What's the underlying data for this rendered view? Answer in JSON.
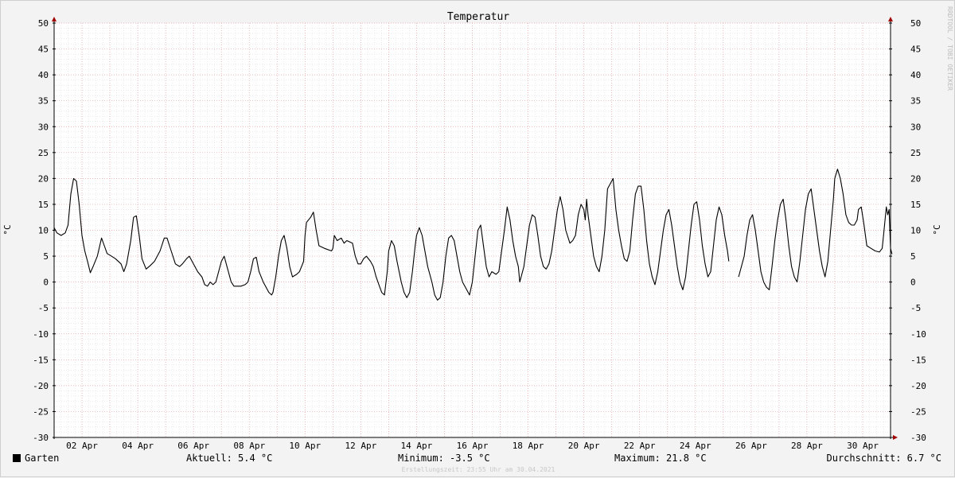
{
  "chart_data": {
    "type": "line",
    "title": "Temperatur",
    "ylabel": "°C",
    "xlabel": "",
    "ylim": [
      -30,
      50
    ],
    "y_ticks": [
      50,
      45,
      40,
      35,
      30,
      25,
      20,
      15,
      10,
      5,
      0,
      -5,
      -10,
      -15,
      -20,
      -25,
      -30
    ],
    "x_ticks": [
      "02 Apr",
      "04 Apr",
      "06 Apr",
      "08 Apr",
      "10 Apr",
      "12 Apr",
      "14 Apr",
      "16 Apr",
      "18 Apr",
      "20 Apr",
      "22 Apr",
      "24 Apr",
      "26 Apr",
      "28 Apr",
      "30 Apr"
    ],
    "x_tick_days": [
      2,
      4,
      6,
      8,
      10,
      12,
      14,
      16,
      18,
      20,
      22,
      24,
      26,
      28,
      30
    ],
    "xlim_days": [
      1.0,
      31.0
    ],
    "grid": true,
    "series": [
      {
        "name": "Garten",
        "color": "#000000",
        "points": [
          [
            1.0,
            10.5
          ],
          [
            1.1,
            9.5
          ],
          [
            1.25,
            9.0
          ],
          [
            1.4,
            9.5
          ],
          [
            1.5,
            11
          ],
          [
            1.6,
            17
          ],
          [
            1.7,
            20
          ],
          [
            1.8,
            19.5
          ],
          [
            1.9,
            15
          ],
          [
            2.0,
            9
          ],
          [
            2.1,
            6
          ],
          [
            2.2,
            4
          ],
          [
            2.3,
            1.8
          ],
          [
            2.4,
            3
          ],
          [
            2.55,
            5
          ],
          [
            2.7,
            8.5
          ],
          [
            2.8,
            7
          ],
          [
            2.9,
            5.5
          ],
          [
            3.0,
            5.2
          ],
          [
            3.2,
            4.5
          ],
          [
            3.4,
            3.5
          ],
          [
            3.5,
            2
          ],
          [
            3.6,
            3.5
          ],
          [
            3.75,
            8
          ],
          [
            3.85,
            12.5
          ],
          [
            3.95,
            12.8
          ],
          [
            4.05,
            9
          ],
          [
            4.15,
            4.5
          ],
          [
            4.3,
            2.5
          ],
          [
            4.45,
            3.2
          ],
          [
            4.6,
            4
          ],
          [
            4.8,
            6
          ],
          [
            4.95,
            8.5
          ],
          [
            5.05,
            8.5
          ],
          [
            5.2,
            6
          ],
          [
            5.35,
            3.5
          ],
          [
            5.5,
            3
          ],
          [
            5.6,
            3.5
          ],
          [
            5.75,
            4.5
          ],
          [
            5.85,
            5
          ],
          [
            5.95,
            4
          ],
          [
            6.05,
            3
          ],
          [
            6.15,
            2
          ],
          [
            6.3,
            1
          ],
          [
            6.4,
            -0.5
          ],
          [
            6.5,
            -0.8
          ],
          [
            6.6,
            0
          ],
          [
            6.7,
            -0.5
          ],
          [
            6.8,
            0
          ],
          [
            6.9,
            2
          ],
          [
            7.0,
            4
          ],
          [
            7.1,
            5
          ],
          [
            7.2,
            3
          ],
          [
            7.35,
            0
          ],
          [
            7.45,
            -0.8
          ],
          [
            7.55,
            -0.8
          ],
          [
            7.7,
            -0.8
          ],
          [
            7.85,
            -0.5
          ],
          [
            7.95,
            0
          ],
          [
            8.05,
            2
          ],
          [
            8.15,
            4.5
          ],
          [
            8.25,
            4.8
          ],
          [
            8.35,
            2
          ],
          [
            8.5,
            0
          ],
          [
            8.6,
            -1
          ],
          [
            8.7,
            -2
          ],
          [
            8.8,
            -2.5
          ],
          [
            8.85,
            -2
          ],
          [
            8.95,
            1
          ],
          [
            9.05,
            5
          ],
          [
            9.15,
            8
          ],
          [
            9.25,
            9
          ],
          [
            9.35,
            6.5
          ],
          [
            9.45,
            3
          ],
          [
            9.55,
            1
          ],
          [
            9.7,
            1.5
          ],
          [
            9.8,
            2
          ],
          [
            9.95,
            4
          ],
          [
            10.0,
            9
          ],
          [
            10.05,
            11.5
          ],
          [
            10.2,
            12.5
          ],
          [
            10.3,
            13.5
          ],
          [
            10.4,
            10
          ],
          [
            10.5,
            7
          ],
          [
            10.7,
            6.5
          ],
          [
            10.95,
            6
          ],
          [
            11.0,
            6.5
          ],
          [
            11.05,
            9
          ],
          [
            11.15,
            8
          ],
          [
            11.3,
            8.5
          ],
          [
            11.4,
            7.5
          ],
          [
            11.5,
            8
          ],
          [
            11.7,
            7.5
          ],
          [
            11.8,
            5
          ],
          [
            11.9,
            3.5
          ],
          [
            12.0,
            3.5
          ],
          [
            12.1,
            4.5
          ],
          [
            12.2,
            5
          ],
          [
            12.35,
            4
          ],
          [
            12.45,
            3
          ],
          [
            12.55,
            1
          ],
          [
            12.65,
            -0.5
          ],
          [
            12.75,
            -2
          ],
          [
            12.85,
            -2.5
          ],
          [
            12.95,
            2
          ],
          [
            13.0,
            6
          ],
          [
            13.1,
            8
          ],
          [
            13.2,
            7
          ],
          [
            13.3,
            4
          ],
          [
            13.45,
            0
          ],
          [
            13.55,
            -2
          ],
          [
            13.65,
            -3
          ],
          [
            13.75,
            -2
          ],
          [
            13.85,
            2
          ],
          [
            13.95,
            7
          ],
          [
            14.0,
            9
          ],
          [
            14.1,
            10.5
          ],
          [
            14.2,
            9
          ],
          [
            14.3,
            6
          ],
          [
            14.4,
            3
          ],
          [
            14.55,
            0
          ],
          [
            14.65,
            -2.5
          ],
          [
            14.75,
            -3.5
          ],
          [
            14.85,
            -3
          ],
          [
            14.95,
            0
          ],
          [
            15.05,
            5
          ],
          [
            15.15,
            8.5
          ],
          [
            15.25,
            9
          ],
          [
            15.35,
            8
          ],
          [
            15.45,
            5
          ],
          [
            15.55,
            2
          ],
          [
            15.65,
            0
          ],
          [
            15.8,
            -1.5
          ],
          [
            15.9,
            -2.5
          ],
          [
            16.0,
            0
          ],
          [
            16.1,
            5
          ],
          [
            16.2,
            10
          ],
          [
            16.3,
            11
          ],
          [
            16.4,
            7
          ],
          [
            16.5,
            3
          ],
          [
            16.6,
            1
          ],
          [
            16.7,
            2
          ],
          [
            16.85,
            1.5
          ],
          [
            16.95,
            2
          ],
          [
            17.05,
            6
          ],
          [
            17.15,
            10
          ],
          [
            17.25,
            14.5
          ],
          [
            17.35,
            12
          ],
          [
            17.45,
            8
          ],
          [
            17.55,
            5
          ],
          [
            17.65,
            3
          ],
          [
            17.7,
            0
          ],
          [
            17.85,
            3
          ],
          [
            17.95,
            7
          ],
          [
            18.05,
            11
          ],
          [
            18.15,
            13
          ],
          [
            18.25,
            12.5
          ],
          [
            18.35,
            9
          ],
          [
            18.45,
            5
          ],
          [
            18.55,
            3
          ],
          [
            18.65,
            2.5
          ],
          [
            18.75,
            3.5
          ],
          [
            18.85,
            6
          ],
          [
            18.95,
            10
          ],
          [
            19.05,
            14
          ],
          [
            19.15,
            16.5
          ],
          [
            19.25,
            14
          ],
          [
            19.35,
            10
          ],
          [
            19.5,
            7.5
          ],
          [
            19.6,
            8
          ],
          [
            19.7,
            9
          ],
          [
            19.8,
            13
          ],
          [
            19.9,
            15
          ],
          [
            20.0,
            14
          ],
          [
            20.05,
            12
          ],
          [
            20.1,
            16
          ],
          [
            20.15,
            13
          ],
          [
            20.25,
            9
          ],
          [
            20.35,
            5
          ],
          [
            20.45,
            3
          ],
          [
            20.55,
            2
          ],
          [
            20.65,
            5
          ],
          [
            20.75,
            10
          ],
          [
            20.85,
            18
          ],
          [
            20.95,
            19
          ],
          [
            21.05,
            20
          ],
          [
            21.15,
            14
          ],
          [
            21.25,
            10
          ],
          [
            21.35,
            7
          ],
          [
            21.45,
            4.5
          ],
          [
            21.55,
            4
          ],
          [
            21.65,
            6
          ],
          [
            21.75,
            12
          ],
          [
            21.85,
            17
          ],
          [
            21.95,
            18.5
          ],
          [
            22.05,
            18.5
          ],
          [
            22.15,
            14
          ],
          [
            22.25,
            8
          ],
          [
            22.35,
            3.5
          ],
          [
            22.45,
            1
          ],
          [
            22.55,
            -0.5
          ],
          [
            22.65,
            2
          ],
          [
            22.75,
            6
          ],
          [
            22.85,
            10
          ],
          [
            22.95,
            13
          ],
          [
            23.05,
            14
          ],
          [
            23.15,
            11
          ],
          [
            23.25,
            7
          ],
          [
            23.35,
            3
          ],
          [
            23.45,
            0
          ],
          [
            23.55,
            -1.5
          ],
          [
            23.65,
            1
          ],
          [
            23.75,
            6
          ],
          [
            23.85,
            11
          ],
          [
            23.95,
            15
          ],
          [
            24.05,
            15.5
          ],
          [
            24.15,
            12
          ],
          [
            24.25,
            7
          ],
          [
            24.35,
            3.5
          ],
          [
            24.45,
            1
          ],
          [
            24.55,
            2
          ],
          [
            24.65,
            7
          ],
          [
            24.75,
            12
          ],
          [
            24.85,
            14.5
          ],
          [
            24.95,
            13
          ],
          [
            25.05,
            9
          ],
          [
            25.15,
            6
          ],
          [
            25.2,
            4
          ]
        ],
        "points_b": [
          [
            25.55,
            1
          ],
          [
            25.65,
            3
          ],
          [
            25.75,
            5
          ],
          [
            25.85,
            9
          ],
          [
            25.95,
            12
          ],
          [
            26.05,
            13
          ],
          [
            26.15,
            10
          ],
          [
            26.25,
            6
          ],
          [
            26.35,
            2
          ],
          [
            26.45,
            0
          ],
          [
            26.55,
            -1
          ],
          [
            26.65,
            -1.5
          ],
          [
            26.75,
            3
          ],
          [
            26.85,
            8
          ],
          [
            26.95,
            12
          ],
          [
            27.05,
            15
          ],
          [
            27.15,
            16
          ],
          [
            27.25,
            12
          ],
          [
            27.35,
            7
          ],
          [
            27.45,
            3
          ],
          [
            27.55,
            1
          ],
          [
            27.65,
            0
          ],
          [
            27.75,
            4
          ],
          [
            27.85,
            9
          ],
          [
            27.95,
            14
          ],
          [
            28.05,
            17
          ],
          [
            28.15,
            18
          ],
          [
            28.25,
            14
          ],
          [
            28.35,
            10
          ],
          [
            28.45,
            6
          ],
          [
            28.55,
            3
          ],
          [
            28.65,
            1
          ],
          [
            28.75,
            4
          ],
          [
            28.85,
            10
          ],
          [
            28.95,
            16
          ],
          [
            29.0,
            20
          ],
          [
            29.1,
            21.8
          ],
          [
            29.2,
            20
          ],
          [
            29.3,
            17
          ],
          [
            29.4,
            13
          ],
          [
            29.5,
            11.5
          ],
          [
            29.6,
            11
          ],
          [
            29.7,
            11
          ],
          [
            29.8,
            12
          ],
          [
            29.85,
            14
          ],
          [
            29.95,
            14.5
          ],
          [
            30.05,
            11
          ],
          [
            30.15,
            7
          ],
          [
            30.3,
            6.5
          ],
          [
            30.45,
            6
          ],
          [
            30.6,
            5.8
          ],
          [
            30.7,
            6.5
          ],
          [
            30.75,
            9
          ],
          [
            30.85,
            14.5
          ],
          [
            30.9,
            13
          ],
          [
            30.95,
            14
          ],
          [
            31.0,
            6.5
          ],
          [
            31.05,
            5.4
          ]
        ]
      }
    ]
  },
  "watermark": "RRDTOOL / TOBI OETIKER",
  "legend": {
    "label": "Garten",
    "color": "#000000"
  },
  "stats": {
    "current": "Aktuell: 5.4 °C",
    "minimum": "Minimum: -3.5 °C",
    "maximum": "Maximum: 21.8 °C",
    "average": "Durchschnitt: 6.7 °C"
  },
  "created": "Erstellungszeit: 23:55 Uhr am 30.04.2021"
}
